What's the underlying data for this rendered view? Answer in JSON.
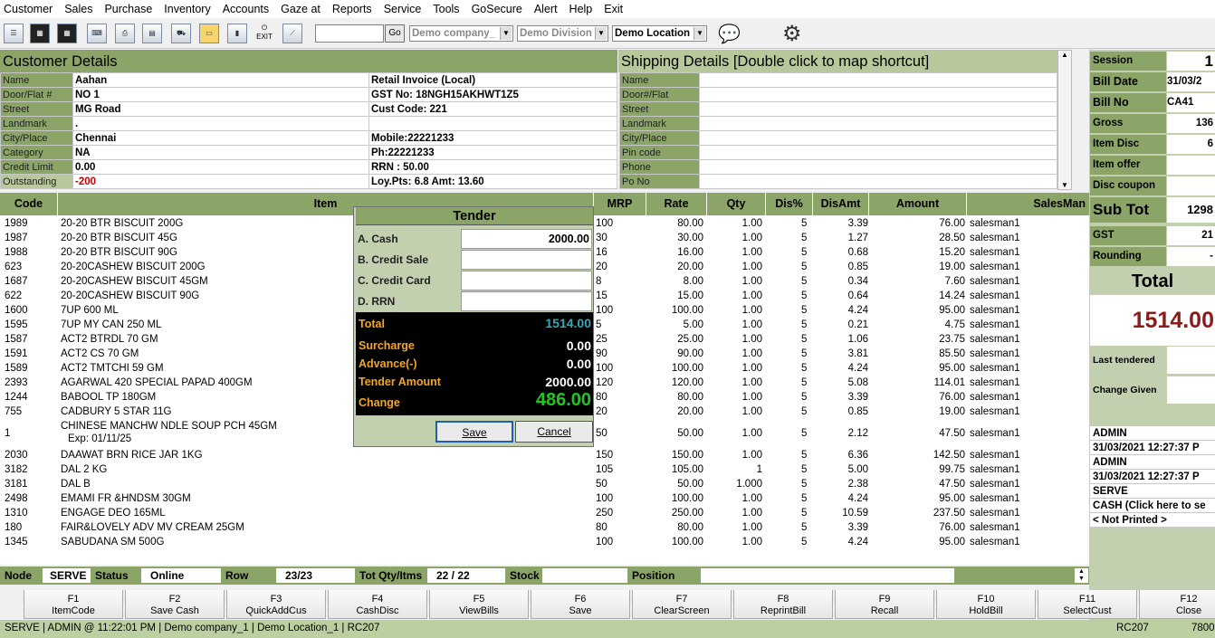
{
  "menu": [
    "Customer",
    "Sales",
    "Purchase",
    "Inventory",
    "Accounts",
    "Gaze at",
    "Reports",
    "Service",
    "Tools",
    "GoSecure",
    "Alert",
    "Help",
    "Exit"
  ],
  "toolbar": {
    "exit_label": "EXIT",
    "go_label": "Go",
    "company": "Demo company_",
    "division": "Demo Division",
    "location": "Demo Location"
  },
  "customer": {
    "heading": "Customer Details",
    "rows": [
      {
        "label": "Name",
        "value": "Aahan",
        "right": "Retail Invoice (Local)"
      },
      {
        "label": "Door/Flat #",
        "value": "NO 1",
        "right": "GST No: 18NGH15AKHWT1Z5"
      },
      {
        "label": "Street",
        "value": "MG Road",
        "right": "Cust Code: 221"
      },
      {
        "label": "Landmark",
        "value": ".",
        "right": ""
      },
      {
        "label": "City/Place",
        "value": "Chennai",
        "right": "Mobile:22221233"
      },
      {
        "label": "Category",
        "value": "NA",
        "right": "Ph:22221233"
      },
      {
        "label": "Credit Limit",
        "value": "0.00",
        "right": "RRN : 50.00"
      },
      {
        "label": "Outstanding",
        "value": "-200",
        "right": "Loy.Pts: 6.8  Amt: 13.60"
      }
    ]
  },
  "shipping": {
    "heading": "Shipping Details   [Double click to map shortcut]",
    "labels": [
      "Name",
      "Door#/Flat",
      "Street",
      "Landmark",
      "City/Place",
      "Pin code",
      "Phone",
      "Po No"
    ]
  },
  "grid": {
    "headers": [
      "Code",
      "Item",
      "MRP",
      "Rate",
      "Qty",
      "Dis%",
      "DisAmt",
      "Amount",
      "SalesMan"
    ],
    "rows": [
      [
        "1989",
        "20-20 BTR BISCUIT 200G",
        "",
        "100",
        "80.00",
        "1.00",
        "5",
        "3.39",
        "76.00",
        "salesman1"
      ],
      [
        "1987",
        "20-20 BTR BISCUIT 45G",
        "",
        "30",
        "30.00",
        "1.00",
        "5",
        "1.27",
        "28.50",
        "salesman1"
      ],
      [
        "1988",
        "20-20 BTR BISCUIT 90G",
        "",
        "16",
        "16.00",
        "1.00",
        "5",
        "0.68",
        "15.20",
        "salesman1"
      ],
      [
        "623",
        "20-20CASHEW BISCUIT 200G",
        "",
        "20",
        "20.00",
        "1.00",
        "5",
        "0.85",
        "19.00",
        "salesman1"
      ],
      [
        "1687",
        "20-20CASHEW BISCUIT 45GM",
        "",
        "8",
        "8.00",
        "1.00",
        "5",
        "0.34",
        "7.60",
        "salesman1"
      ],
      [
        "622",
        "20-20CASHEW BISCUIT 90G",
        "",
        "15",
        "15.00",
        "1.00",
        "5",
        "0.64",
        "14.24",
        "salesman1"
      ],
      [
        "1600",
        "7UP 600 ML",
        "",
        "100",
        "100.00",
        "1.00",
        "5",
        "4.24",
        "95.00",
        "salesman1"
      ],
      [
        "1595",
        "7UP MY CAN 250 ML",
        "",
        "5",
        "5.00",
        "1.00",
        "5",
        "0.21",
        "4.75",
        "salesman1"
      ],
      [
        "1587",
        "ACT2 BTRDL 70 GM",
        "",
        "25",
        "25.00",
        "1.00",
        "5",
        "1.06",
        "23.75",
        "salesman1"
      ],
      [
        "1591",
        "ACT2 CS 70 GM",
        "",
        "90",
        "90.00",
        "1.00",
        "5",
        "3.81",
        "85.50",
        "salesman1"
      ],
      [
        "1589",
        "ACT2 TMTCHI 59 GM",
        "",
        "100",
        "100.00",
        "1.00",
        "5",
        "4.24",
        "95.00",
        "salesman1"
      ],
      [
        "2393",
        "AGARWAL 420 SPECIAL PAPAD 400GM",
        "",
        "120",
        "120.00",
        "1.00",
        "5",
        "5.08",
        "114.01",
        "salesman1"
      ],
      [
        "1244",
        "BABOOL TP 180GM",
        "",
        "80",
        "80.00",
        "1.00",
        "5",
        "3.39",
        "76.00",
        "salesman1"
      ],
      [
        "755",
        "CADBURY 5 STAR 11G",
        "",
        "20",
        "20.00",
        "1.00",
        "5",
        "0.85",
        "19.00",
        "salesman1"
      ],
      [
        "1",
        "CHINESE MANCHW NDLE SOUP PCH 45GM",
        "Exp: 01/11/25",
        "50",
        "50.00",
        "1.00",
        "5",
        "2.12",
        "47.50",
        "salesman1"
      ],
      [
        "2030",
        "DAAWAT BRN RICE JAR 1KG",
        "",
        "150",
        "150.00",
        "1.00",
        "5",
        "6.36",
        "142.50",
        "salesman1"
      ],
      [
        "3182",
        "DAL 2 KG",
        "",
        "105",
        "105.00",
        "1",
        "5",
        "5.00",
        "99.75",
        "salesman1"
      ],
      [
        "3181",
        "DAL B",
        "",
        "50",
        "50.00",
        "1.000",
        "5",
        "2.38",
        "47.50",
        "salesman1"
      ],
      [
        "2498",
        "EMAMI FR &HNDSM 30GM",
        "",
        "100",
        "100.00",
        "1.00",
        "5",
        "4.24",
        "95.00",
        "salesman1"
      ],
      [
        "1310",
        "ENGAGE DEO 165ML",
        "",
        "250",
        "250.00",
        "1.00",
        "5",
        "10.59",
        "237.50",
        "salesman1"
      ],
      [
        "180",
        "FAIR&LOVELY ADV MV CREAM 25GM",
        "",
        "80",
        "80.00",
        "1.00",
        "5",
        "3.39",
        "76.00",
        "salesman1"
      ],
      [
        "1345",
        "SABUDANA SM 500G",
        "",
        "100",
        "100.00",
        "1.00",
        "5",
        "4.24",
        "95.00",
        "salesman1"
      ]
    ]
  },
  "tender": {
    "title": "Tender",
    "rows": [
      {
        "label": "A. Cash",
        "value": "2000.00"
      },
      {
        "label": "B. Credit Sale",
        "value": ""
      },
      {
        "label": "C. Credit Card",
        "value": ""
      },
      {
        "label": "D. RRN",
        "value": ""
      }
    ],
    "total_label": "Total",
    "total": "1514.00",
    "surcharge_label": "Surcharge",
    "surcharge": "0.00",
    "advance_label": "Advance(-)",
    "advance": "0.00",
    "tender_amount_label": "Tender Amount",
    "tender_amount": "2000.00",
    "change_label": "Change",
    "change": "486.00",
    "save_label": "Save",
    "cancel_label": "Cancel"
  },
  "summary": {
    "session_label": "Session",
    "session": "1",
    "bill_date_label": "Bill Date",
    "bill_date": "31/03/2",
    "bill_no_label": "Bill No",
    "bill_no": "CA41",
    "gross_label": "Gross",
    "gross": "136",
    "item_disc_label": "Item Disc",
    "item_disc": "6",
    "item_offer_label": "Item offer",
    "item_offer": "",
    "disc_coupon_label": "Disc coupon",
    "disc_coupon": "",
    "subtot_label": "Sub Tot",
    "subtot": "1298",
    "gst_label": "GST",
    "gst": "21",
    "rounding_label": "Rounding",
    "rounding": "-",
    "total_label": "Total",
    "total": "1514.00",
    "last_tendered_label": "Last tendered",
    "last_tendered": "",
    "change_given_label": "Change Given",
    "change_given": "",
    "log": [
      "ADMIN",
      "31/03/2021 12:27:37 P",
      "ADMIN",
      "31/03/2021 12:27:37 P",
      "SERVE",
      "CASH  (Click here to se",
      "< Not Printed >"
    ]
  },
  "status": {
    "node_label": "Node",
    "node": "SERVE",
    "status_label": "Status",
    "status": "Online",
    "row_label": "Row",
    "row": "23/23",
    "totqty_label": "Tot Qty/Itms",
    "totqty": "22 / 22",
    "stock_label": "Stock",
    "stock": "",
    "position_label": "Position",
    "position": ""
  },
  "fkeys": [
    {
      "k": "F1",
      "l": "ItemCode"
    },
    {
      "k": "F2",
      "l": "Save  Cash"
    },
    {
      "k": "F3",
      "l": "QuickAddCus"
    },
    {
      "k": "F4",
      "l": "CashDisc"
    },
    {
      "k": "F5",
      "l": "ViewBills"
    },
    {
      "k": "F6",
      "l": "Save"
    },
    {
      "k": "F7",
      "l": "ClearScreen"
    },
    {
      "k": "F8",
      "l": "ReprintBill"
    },
    {
      "k": "F9",
      "l": "Recall"
    },
    {
      "k": "F10",
      "l": "HoldBill"
    },
    {
      "k": "F11",
      "l": "SelectCust"
    },
    {
      "k": "F12",
      "l": "Close"
    }
  ],
  "bottom": {
    "left": "SERVE | ADMIN  @ 11:22:01 PM   | Demo company_1   | Demo Location_1  | RC207",
    "rc": "RC207",
    "num": "7800"
  }
}
